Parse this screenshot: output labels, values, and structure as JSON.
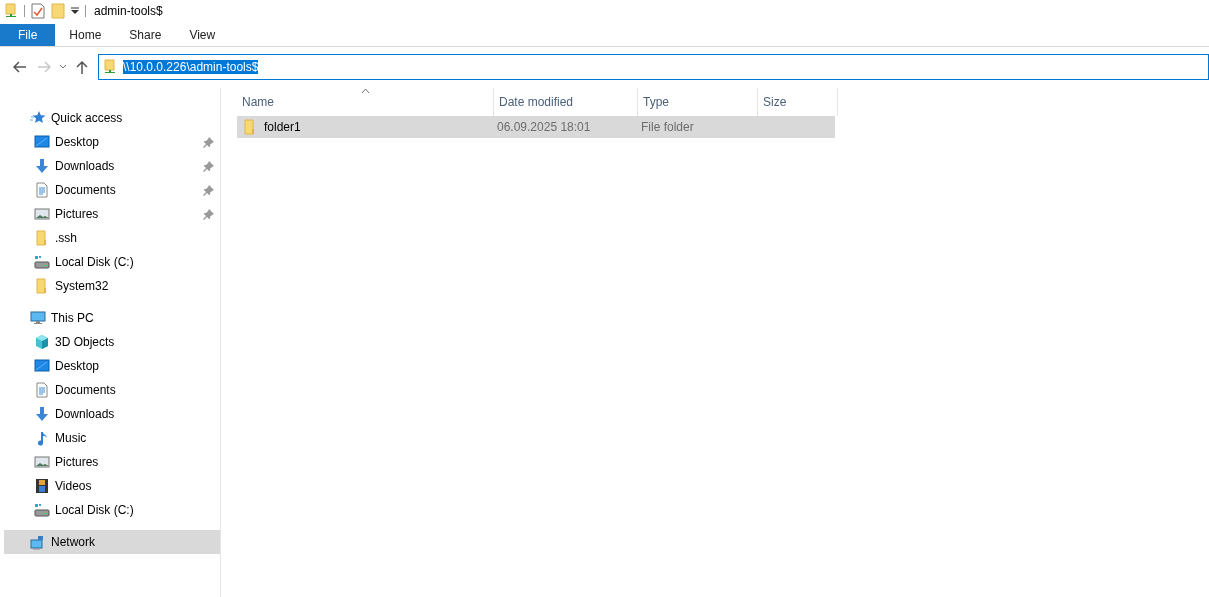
{
  "window": {
    "title": "admin-tools$"
  },
  "ribbon_tabs": [
    {
      "label": "File",
      "selected": true
    },
    {
      "label": "Home",
      "selected": false
    },
    {
      "label": "Share",
      "selected": false
    },
    {
      "label": "View",
      "selected": false
    }
  ],
  "navigation": {
    "forward_disabled": true
  },
  "address_bar": {
    "value": "\\\\10.0.0.226\\admin-tools$",
    "text_selected": true
  },
  "sidebar": {
    "groups": [
      {
        "label": "Quick access",
        "kind": "star",
        "selected": false,
        "children": [
          {
            "label": "Desktop",
            "kind": "desktop",
            "pinned": true
          },
          {
            "label": "Downloads",
            "kind": "downloads",
            "pinned": true
          },
          {
            "label": "Documents",
            "kind": "documents",
            "pinned": true
          },
          {
            "label": "Pictures",
            "kind": "pictures",
            "pinned": true
          },
          {
            "label": ".ssh",
            "kind": "folder",
            "pinned": false
          },
          {
            "label": "Local Disk (C:)",
            "kind": "drive",
            "pinned": false
          },
          {
            "label": "System32",
            "kind": "folder",
            "pinned": false
          }
        ]
      },
      {
        "label": "This PC",
        "kind": "pc",
        "selected": false,
        "children": [
          {
            "label": "3D Objects",
            "kind": "cube",
            "pinned": false
          },
          {
            "label": "Desktop",
            "kind": "desktop",
            "pinned": false
          },
          {
            "label": "Documents",
            "kind": "documents",
            "pinned": false
          },
          {
            "label": "Downloads",
            "kind": "downloads",
            "pinned": false
          },
          {
            "label": "Music",
            "kind": "music",
            "pinned": false
          },
          {
            "label": "Pictures",
            "kind": "pictures",
            "pinned": false
          },
          {
            "label": "Videos",
            "kind": "videos",
            "pinned": false
          },
          {
            "label": "Local Disk (C:)",
            "kind": "drive",
            "pinned": false
          }
        ]
      },
      {
        "label": "Network",
        "kind": "network",
        "selected": true
      }
    ]
  },
  "file_list": {
    "columns": [
      {
        "label": "Name",
        "sorted": true
      },
      {
        "label": "Date modified",
        "sorted": false
      },
      {
        "label": "Type",
        "sorted": false
      },
      {
        "label": "Size",
        "sorted": false
      }
    ],
    "rows": [
      {
        "name": "folder1",
        "date_modified": "06.09.2025 18:01",
        "type": "File folder",
        "selected": true
      }
    ]
  }
}
